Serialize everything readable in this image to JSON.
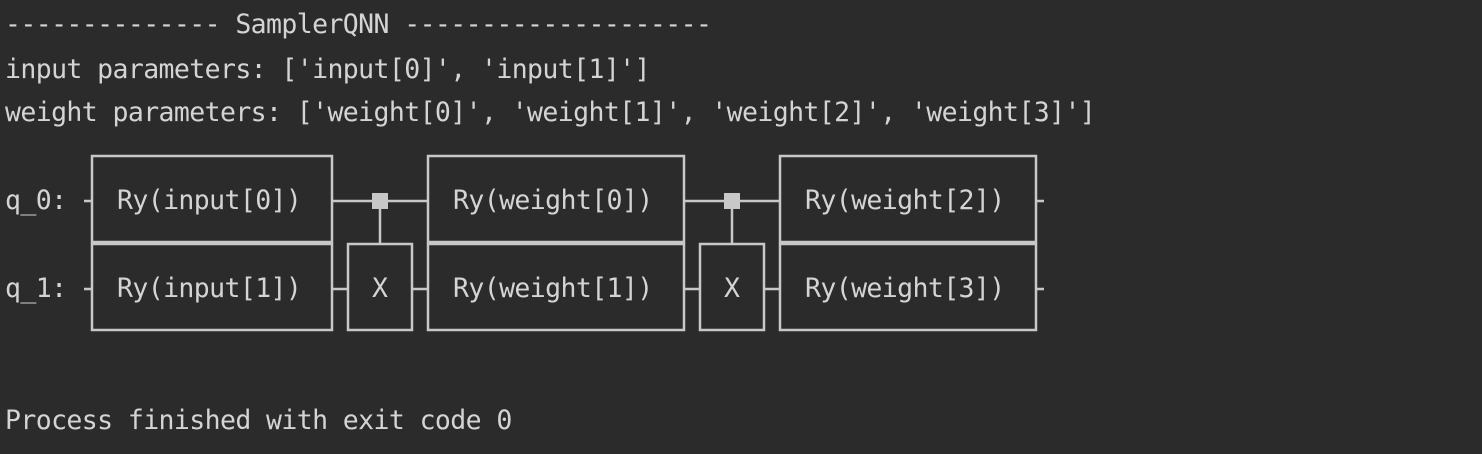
{
  "console": {
    "header_line": "-------------- SamplerQNN --------------------",
    "input_params_line": "input parameters: ['input[0]', 'input[1]']",
    "weight_params_line": "weight parameters: ['weight[0]', 'weight[1]', 'weight[2]', 'weight[3]']",
    "exit_line": "Process finished with exit code 0"
  },
  "circuit": {
    "qubits": [
      {
        "label": "q_0:",
        "gates": [
          "Ry(input[0])",
          "Ry(weight[0])",
          "Ry(weight[2])"
        ]
      },
      {
        "label": "q_1:",
        "gates": [
          "Ry(input[1])",
          "X",
          "Ry(weight[1])",
          "X",
          "Ry(weight[3])"
        ]
      }
    ]
  },
  "colors": {
    "background": "#2b2b2b",
    "text": "#d4d4d4",
    "lines": "#c8c8c8"
  }
}
